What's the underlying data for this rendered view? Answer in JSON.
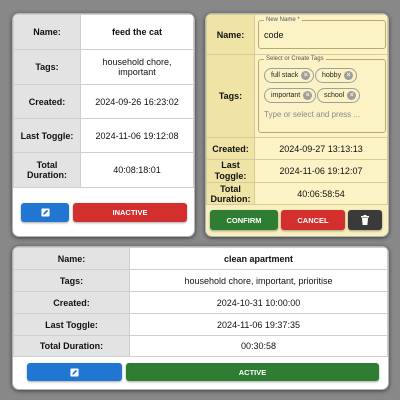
{
  "card1": {
    "rows": [
      {
        "label": "Name:",
        "value": "feed the cat"
      },
      {
        "label": "Tags:",
        "value": "household chore, important"
      },
      {
        "label": "Created:",
        "value": "2024-09-26 16:23:02"
      },
      {
        "label": "Last Toggle:",
        "value": "2024-11-06 19:12:08"
      },
      {
        "label": "Total Duration:",
        "value": "40:08:18:01"
      }
    ],
    "edit_icon": "edit-icon",
    "status_label": "INACTIVE"
  },
  "card2": {
    "name_label": "Name:",
    "name_field_legend": "New Name *",
    "name_value": "code",
    "tags_label": "Tags:",
    "tags_field_legend": "Select or Create Tags",
    "tags": [
      "full stack",
      "hobby",
      "important",
      "school"
    ],
    "tags_placeholder": "Type or select and press ...",
    "rows": [
      {
        "label": "Created:",
        "value": "2024-09-27 13:13:13"
      },
      {
        "label": "Last Toggle:",
        "value": "2024-11-06 19:12:07"
      },
      {
        "label": "Total Duration:",
        "value": "40:06:58:54"
      }
    ],
    "confirm_label": "CONFIRM",
    "cancel_label": "CANCEL",
    "delete_icon": "trash-icon"
  },
  "card3": {
    "rows": [
      {
        "label": "Name:",
        "value": "clean apartment"
      },
      {
        "label": "Tags:",
        "value": "household chore, important, prioritise"
      },
      {
        "label": "Created:",
        "value": "2024-10-31 10:00:00"
      },
      {
        "label": "Last Toggle:",
        "value": "2024-11-06 19:37:35"
      },
      {
        "label": "Total Duration:",
        "value": "00:30:58"
      }
    ],
    "edit_icon": "edit-icon",
    "status_label": "ACTIVE"
  },
  "colors": {
    "background": "#888888",
    "primary_blue": "#2176d2",
    "inactive_red": "#d32f2f",
    "active_green": "#2e7d32",
    "edit_card": "#f8efbe"
  }
}
